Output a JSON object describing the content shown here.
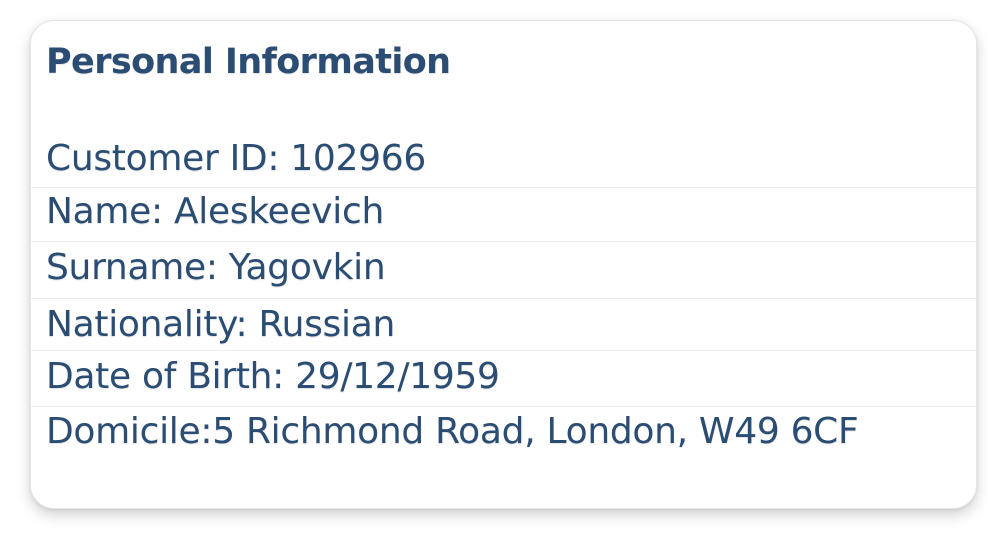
{
  "card": {
    "title": "Personal Information",
    "fields": [
      "Customer ID: 102966",
      "Name: Aleskeevich",
      "Surname: Yagovkin",
      "Nationality: Russian",
      "Date of Birth: 29/12/1959",
      "Domicile:5 Richmond Road, London, W49 6CF"
    ]
  },
  "colors": {
    "text": "#2b4d74",
    "divider": "#eceef1",
    "background": "#ffffff"
  }
}
